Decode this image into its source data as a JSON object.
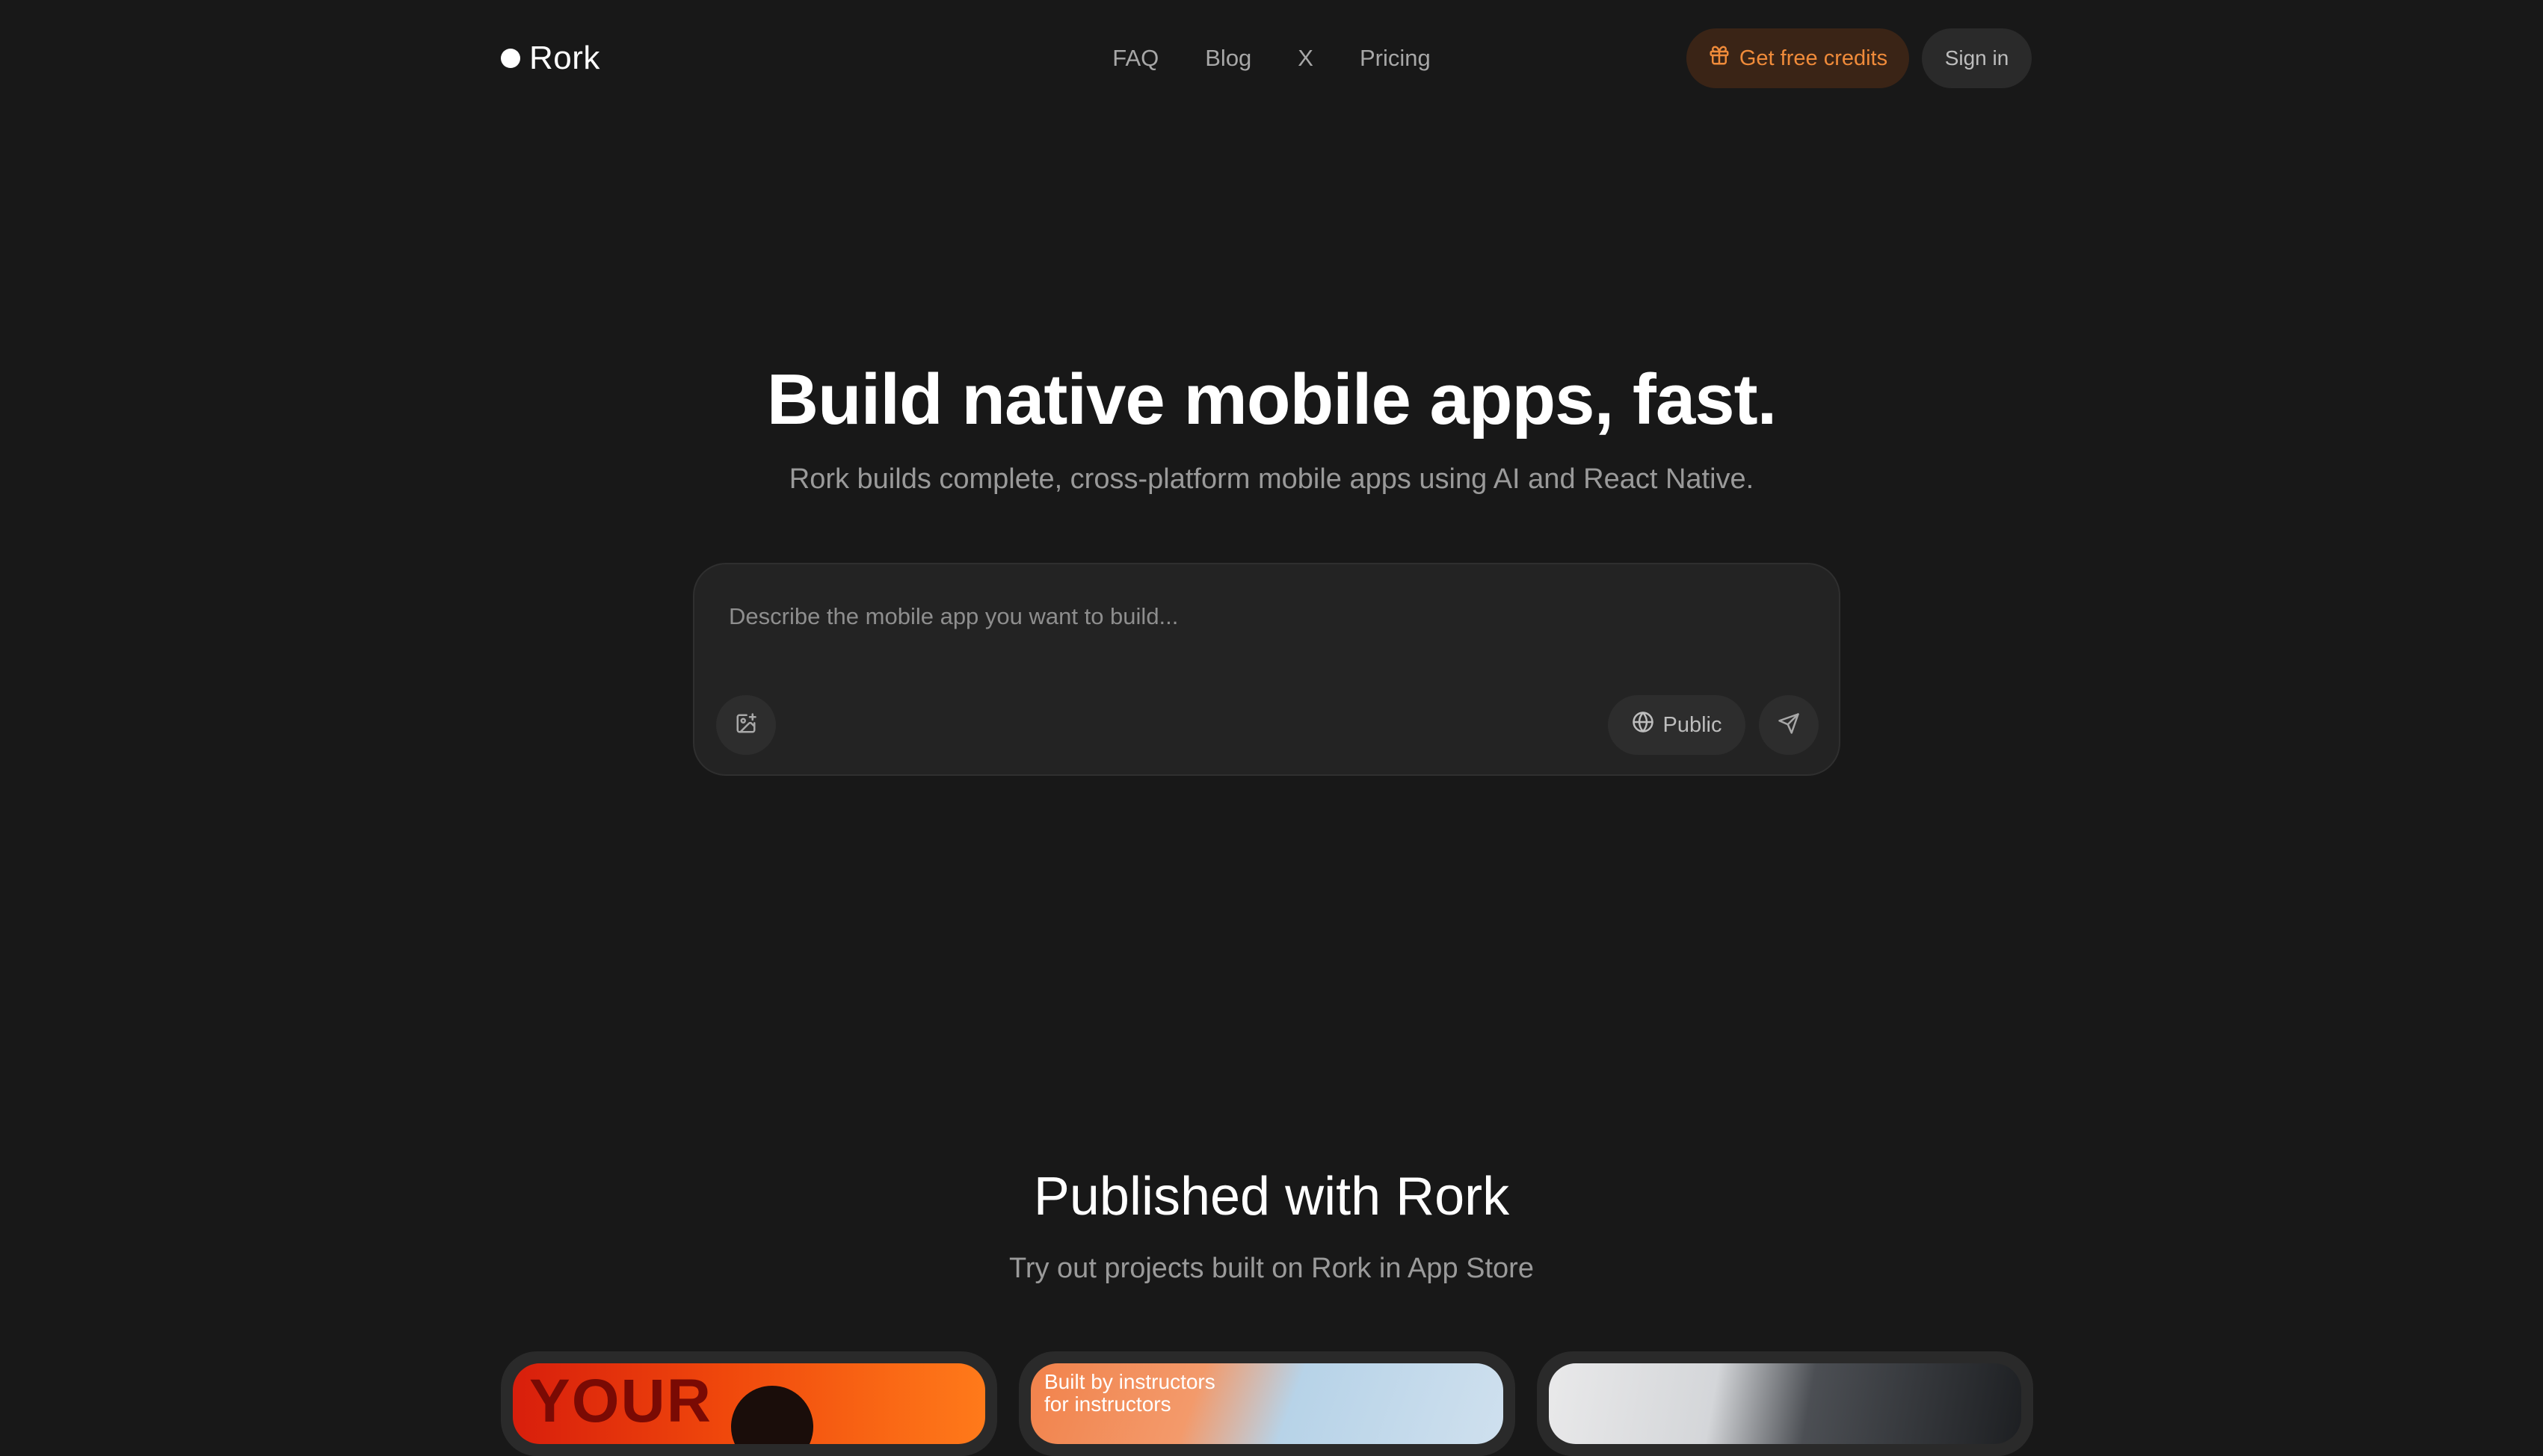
{
  "brand": {
    "name": "Rork"
  },
  "nav": {
    "links": [
      "FAQ",
      "Blog",
      "X",
      "Pricing"
    ]
  },
  "header": {
    "credits_label": "Get free credits",
    "signin_label": "Sign in"
  },
  "hero": {
    "title": "Build native mobile apps, fast.",
    "subtitle": "Rork builds complete, cross-platform mobile apps using AI and React Native."
  },
  "prompt": {
    "placeholder": "Describe the mobile app you want to build...",
    "visibility_label": "Public"
  },
  "published": {
    "title": "Published with Rork",
    "subtitle": "Try out projects built on Rork in App Store",
    "cards": [
      {
        "text": "YOUR"
      },
      {
        "text": "Built by instructors for instructors"
      },
      {
        "text": ""
      }
    ]
  },
  "colors": {
    "background": "#181818",
    "accent": "#f08b3a",
    "credits_bg": "#3a2416"
  }
}
